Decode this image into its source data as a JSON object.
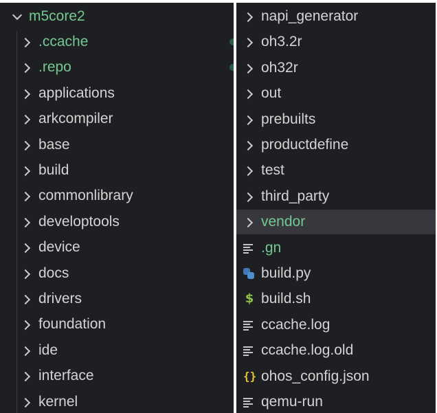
{
  "left": {
    "root": {
      "label": "m5core2",
      "expanded": true
    },
    "items": [
      {
        "label": ".ccache",
        "status": "green",
        "marker": true
      },
      {
        "label": ".repo",
        "status": "green",
        "marker": true
      },
      {
        "label": "applications"
      },
      {
        "label": "arkcompiler"
      },
      {
        "label": "base"
      },
      {
        "label": "build"
      },
      {
        "label": "commonlibrary"
      },
      {
        "label": "developtools"
      },
      {
        "label": "device"
      },
      {
        "label": "docs"
      },
      {
        "label": "drivers"
      },
      {
        "label": "foundation"
      },
      {
        "label": "ide"
      },
      {
        "label": "interface"
      },
      {
        "label": "kernel"
      }
    ]
  },
  "right": {
    "folders": [
      {
        "label": "napi_generator"
      },
      {
        "label": "oh3.2r"
      },
      {
        "label": "oh32r"
      },
      {
        "label": "out"
      },
      {
        "label": "prebuilts"
      },
      {
        "label": "productdefine"
      },
      {
        "label": "test"
      },
      {
        "label": "third_party"
      },
      {
        "label": "vendor",
        "status": "green",
        "selected": true
      }
    ],
    "files": [
      {
        "label": ".gn",
        "icon": "text-lines-icon",
        "status": "green"
      },
      {
        "label": "build.py",
        "icon": "python-icon"
      },
      {
        "label": "build.sh",
        "icon": "shell-dollar-icon",
        "glyph": "$"
      },
      {
        "label": "ccache.log",
        "icon": "text-lines-icon"
      },
      {
        "label": "ccache.log.old",
        "icon": "text-lines-icon"
      },
      {
        "label": "ohos_config.json",
        "icon": "json-braces-icon",
        "glyph": "{}"
      },
      {
        "label": "qemu-run",
        "icon": "text-lines-icon"
      }
    ]
  },
  "colors": {
    "background": "#1e1f22",
    "text": "#d4d4d4",
    "git_untracked": "#73c991",
    "selection": "#37373d"
  }
}
